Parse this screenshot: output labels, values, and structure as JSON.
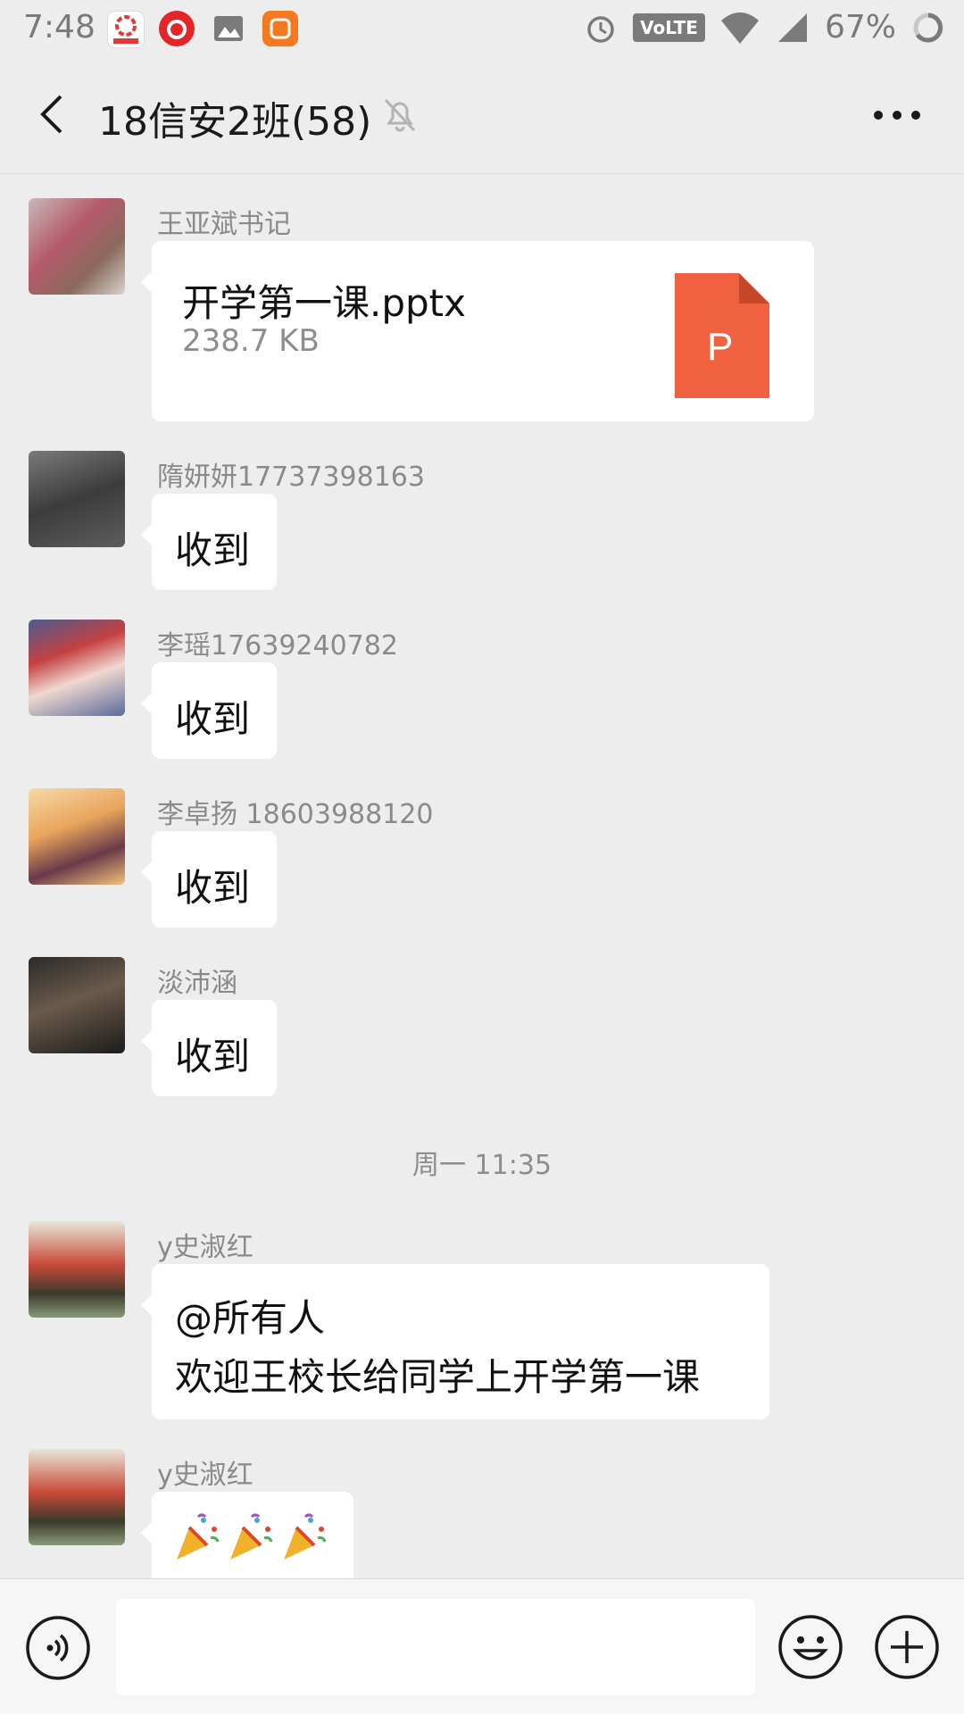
{
  "status_bar": {
    "time": "7:48",
    "volte": "VoLTE",
    "battery": "67%"
  },
  "header": {
    "title": "18信安2班(58)"
  },
  "messages": [
    {
      "sender": "王亚斌书记",
      "type": "file",
      "file_name": "开学第一课.pptx",
      "file_size": "238.7 KB",
      "file_badge": "P"
    },
    {
      "sender": "隋妍妍17737398163",
      "type": "text",
      "text": "收到"
    },
    {
      "sender": "李瑶17639240782",
      "type": "text",
      "text": "收到"
    },
    {
      "sender": "李卓扬 18603988120",
      "type": "text",
      "text": "收到"
    },
    {
      "sender": "淡沛涵",
      "type": "text",
      "text": "收到"
    },
    {
      "sender": "y史淑红",
      "type": "text",
      "lines": [
        "@所有人",
        "欢迎王校长给同学上开学第一课"
      ]
    },
    {
      "sender": "y史淑红",
      "type": "emoji",
      "emoji": [
        "🎉",
        "🎉",
        "🎉"
      ]
    }
  ],
  "timestamp": "周一 11:35",
  "input": {
    "placeholder": ""
  }
}
